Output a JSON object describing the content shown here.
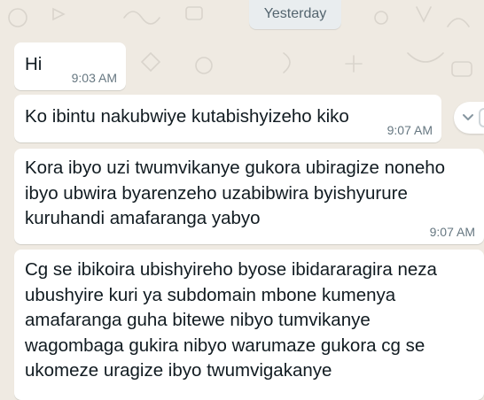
{
  "chat": {
    "date_divider": "Yesterday",
    "messages": [
      {
        "text": "Hi",
        "time": "9:03 AM"
      },
      {
        "text": "Ko ibintu nakubwiye kutabishyizeho kiko",
        "time": "9:07 AM"
      },
      {
        "text": "Kora ibyo uzi twumvikanye gukora  ubiragize noneho ibyo ubwira byarenzeho  uzabibwira byishyurure kuruhandi  amafaranga  yabyo",
        "time": "9:07 AM"
      },
      {
        "text": "Cg se ibikoira ubishyireho byose ibidararagira neza ubushyire kuri ya subdomain   mbone kumenya amafaranga guha bitewe nibyo tumvikanye wagombaga gukira nibyo warumaze gukora cg se ukomeze uragize ibyo twumvigakanye",
        "time": ""
      }
    ]
  },
  "icons": {
    "message_menu": "chevron-down-icon"
  }
}
